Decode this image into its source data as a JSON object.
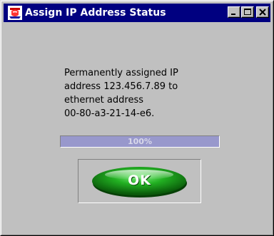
{
  "window": {
    "title": "Assign IP Address Status",
    "icon": "java-app-icon",
    "controls": [
      "minimize-icon",
      "maximize-icon",
      "close-icon"
    ]
  },
  "message": {
    "lines": [
      "Permanently assigned IP",
      "address  123.456.7.89  to",
      "ethernet address",
      "00-80-a3-21-14-e6."
    ]
  },
  "progress": {
    "percent": 100,
    "label": "100%",
    "fill_color": "#9898cc"
  },
  "ok_button": {
    "label": "OK",
    "color": "#22b022"
  },
  "colors": {
    "titlebar": "#000080",
    "background": "#c0c0c0"
  }
}
